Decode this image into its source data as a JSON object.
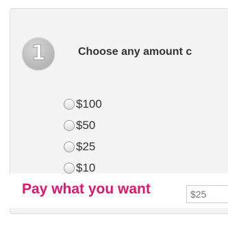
{
  "step": {
    "number": "1",
    "title": "Choose any amount c"
  },
  "amounts": [
    {
      "label": "$100"
    },
    {
      "label": "$50"
    },
    {
      "label": "$25"
    },
    {
      "label": "$10"
    }
  ],
  "custom_input": {
    "placeholder": "$25"
  },
  "overlay": {
    "text": "Pay what you want",
    "color": "#e0156e"
  }
}
